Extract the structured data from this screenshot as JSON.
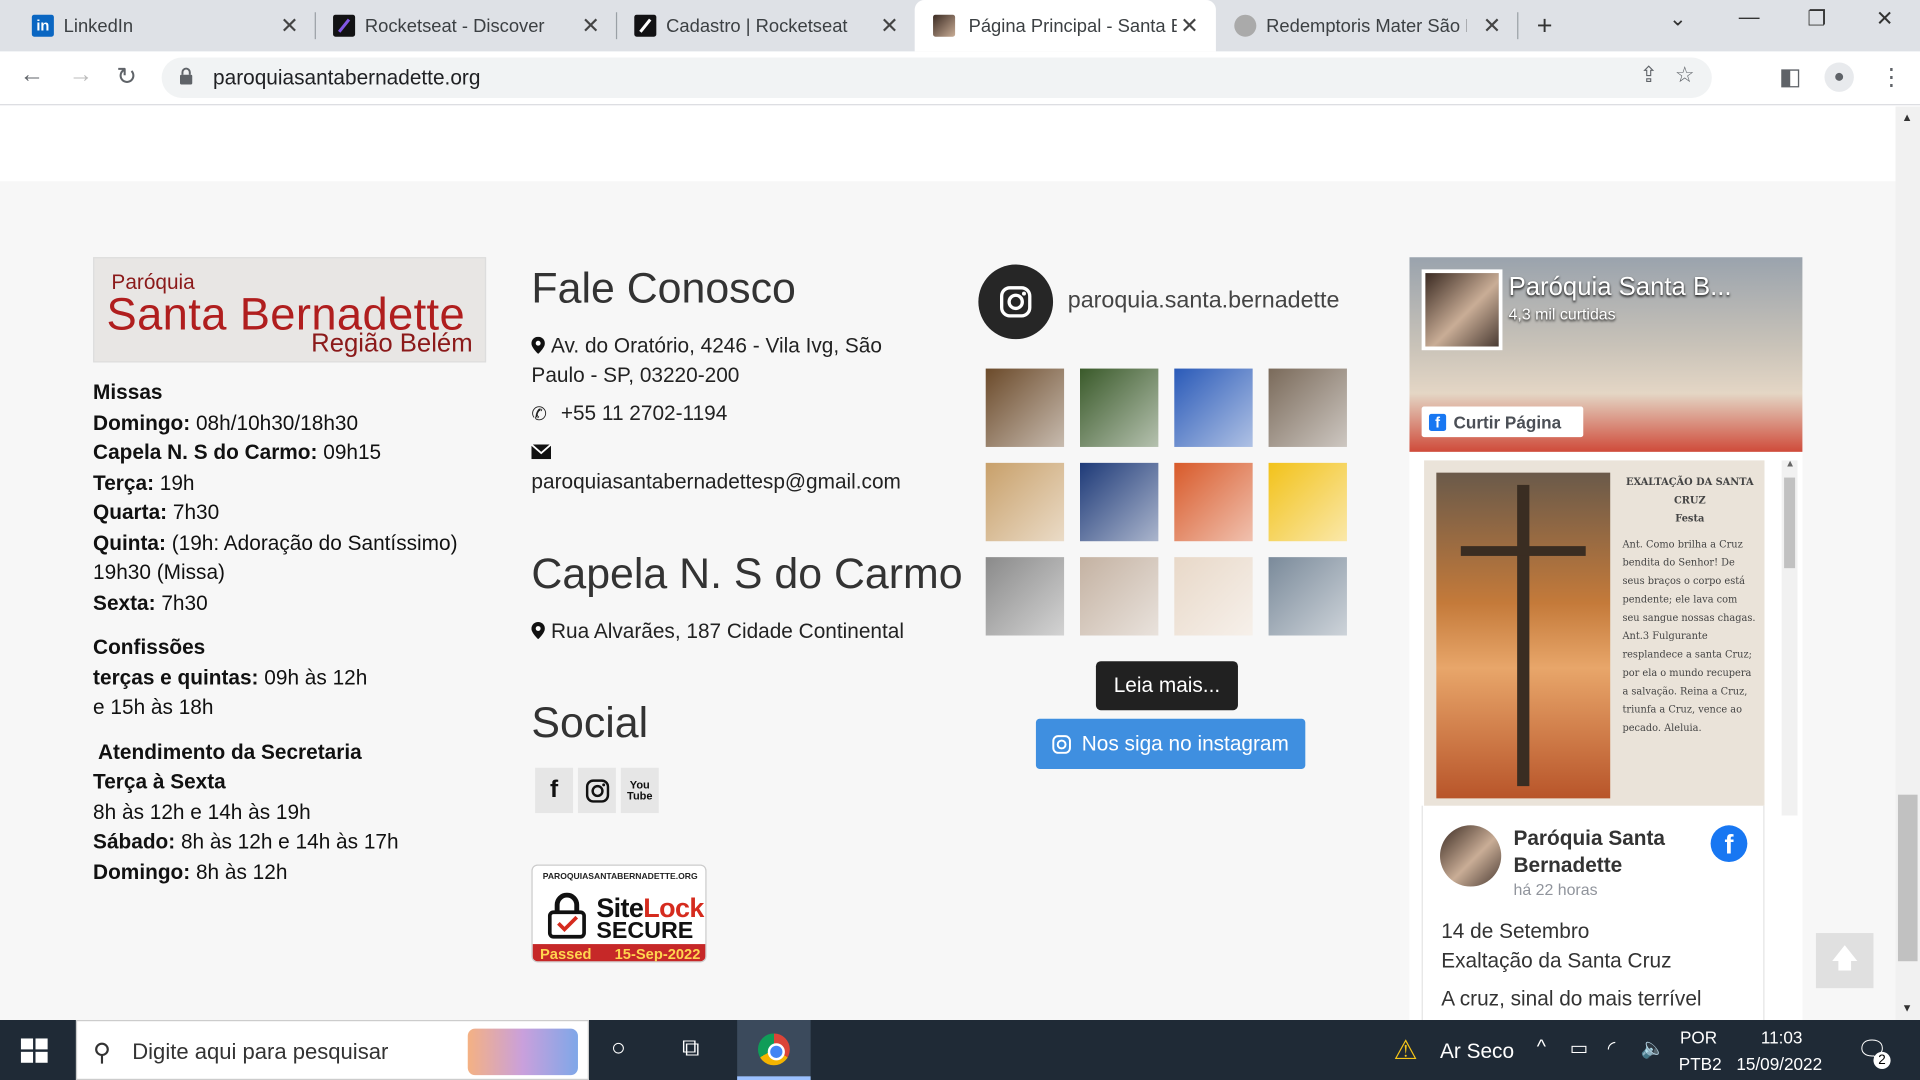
{
  "browser": {
    "tabs": [
      {
        "title": "LinkedIn",
        "icon": "linkedin-icon",
        "color": "#0a66c2"
      },
      {
        "title": "Rocketseat - Discover",
        "icon": "rocketseat-icon",
        "color": "#121214"
      },
      {
        "title": "Cadastro | Rocketseat",
        "icon": "rocketseat-icon",
        "color": "#121214"
      },
      {
        "title": "Página Principal - Santa B",
        "icon": "parish-icon",
        "color": "#5a3a2a",
        "active": true
      },
      {
        "title": "Redemptoris Mater São P",
        "icon": "seal-icon",
        "color": "#999999"
      }
    ],
    "url": "paroquiasantabernadette.org"
  },
  "logo": {
    "line1": "Paróquia",
    "line2": "Santa Bernadette",
    "line3": "Região Belém"
  },
  "schedule": {
    "missas_title": "Missas",
    "rows": [
      {
        "label": "Domingo:",
        "value": "  08h/10h30/18h30"
      },
      {
        "label": "Capela N. S do Carmo:",
        "value": " 09h15"
      },
      {
        "label": "Terça:",
        "value": " 19h"
      },
      {
        "label": "Quarta:",
        "value": " 7h30"
      },
      {
        "label": "Quinta:",
        "value": " (19h: Adoração do Santíssimo) 19h30 (Missa)"
      },
      {
        "label": "Sexta:",
        "value": " 7h30"
      }
    ],
    "confissoes_title": "Confissões",
    "confissoes_label": "terças e quintas:",
    "confissoes_value": " 09h às 12h",
    "confissoes_value2": "e 15h às 18h",
    "secretaria_title": "Atendimento da Secretaria",
    "secretaria_days": "Terça à Sexta",
    "secretaria_hours": "8h às 12h e  14h às 19h",
    "sabado_label": "Sábado:",
    "sabado_value": " 8h às 12h e 14h às 17h",
    "domingo_label": "Domingo:",
    "domingo_value": " 8h às 12h"
  },
  "contact": {
    "title": "Fale Conosco",
    "address": "Av. do Oratório, 4246 - Vila Ivg, São Paulo - SP, 03220-200",
    "phone": "+55 11 2702-1194",
    "email": "paroquiasantabernadettesp@gmail.com",
    "chapel_title": "Capela N. S do Carmo",
    "chapel_address": "Rua Alvarães, 187 Cidade Continental",
    "social_title": "Social"
  },
  "sitelock": {
    "domain": "PAROQUIASANTABERNADETTE.ORG",
    "brand_a": "Site",
    "brand_b": "Lock",
    "secure": "SECURE",
    "passed": "Passed",
    "date": "15-Sep-2022"
  },
  "instagram": {
    "handle": "paroquia.santa.bernadette",
    "read_more": "Leia mais...",
    "follow": "Nos siga no instagram",
    "thumb_colors": [
      "#6b4a2a",
      "#3a5a2a",
      "#2a5ab8",
      "#7a6a5a",
      "#c8a06a",
      "#1e3a78",
      "#d85a2a",
      "#f2c21a",
      "#8a8a8a",
      "#c4b2a2",
      "#e8d8c8",
      "#7a8a9a"
    ]
  },
  "facebook": {
    "page_name": "Paróquia Santa B...",
    "likes": "4,3 mil curtidas",
    "like_button": "Curtir Página",
    "post_title": "EXALTAÇÃO DA SANTA CRUZ",
    "post_subtitle": "Festa",
    "post_text": "Ant. Como brilha a Cruz bendita do Senhor! De seus braços o corpo está pendente; ele lava com seu sangue nossas chagas. Ant.3 Fulgurante resplandece a santa Cruz; por ela o mundo recupera a salvação. Reina a Cruz, triunfa a Cruz, vence ao pecado. Aleluia.",
    "author": "Paróquia Santa Bernadette",
    "time": "há 22 horas",
    "line1": "14 de Setembro",
    "line2": "Exaltação da Santa Cruz",
    "line3": "A cruz, sinal do mais terrível"
  },
  "taskbar": {
    "search_placeholder": "Digite aqui para pesquisar",
    "weather": "Ar Seco",
    "lang": "POR",
    "layout": "PTB2",
    "time": "11:03",
    "date": "15/09/2022",
    "notifications": "2"
  }
}
